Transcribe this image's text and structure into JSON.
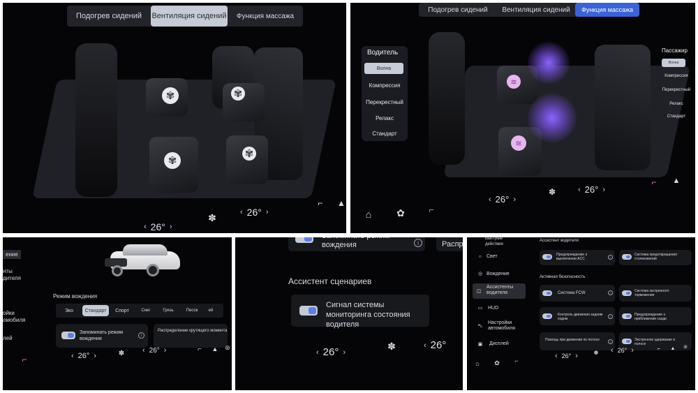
{
  "panel1": {
    "tabs": [
      "Подогрев сидений",
      "Вентиляция сидений",
      "Функция массажа"
    ],
    "active_tab": 1,
    "climate": {
      "left_temp": "26°",
      "right_temp": "26°"
    }
  },
  "panel2": {
    "tabs": [
      "Подогрев сидений",
      "Вентиляция сидений",
      "Функция массажа"
    ],
    "driver_menu": {
      "title": "Водитель",
      "items": [
        "Волна",
        "Компрессия",
        "Перекрестный",
        "Релакс",
        "Стандарт"
      ]
    },
    "passenger_menu": {
      "title": "Пассажир",
      "items": [
        "Волна",
        "Компрессия",
        "Перекрестный",
        "Релакс",
        "Стандарт"
      ]
    },
    "climate": {
      "left_temp": "26°",
      "right_temp": "26°"
    }
  },
  "panel3": {
    "sidebar": [
      "ение",
      "нты\nдителя",
      "ойки\nомобиля",
      "лей"
    ],
    "mode_title": "Режим вождения",
    "modes": [
      "Эко",
      "Стандарт",
      "Спорт",
      "Снег",
      "Грязь",
      "Песок",
      "ей"
    ],
    "remember_label": "Запоминать режим вождения",
    "torque_label": "Распределение крутящего момента",
    "climate": {
      "left_temp": "26°",
      "right_temp": "26°"
    }
  },
  "panel4": {
    "remember_label": "Запоминать режим вождения",
    "right_cut": "Распре",
    "section_title": "Ассистент сценариев",
    "monitor_label": "Сигнал системы мониторинга состояния водителя",
    "climate": {
      "left_temp": "26°",
      "right_temp": "26°"
    }
  },
  "panel5": {
    "sidebar": [
      "Быстрые действия",
      "Свет",
      "Вождение",
      "Ассистенты водителя",
      "HUD",
      "Настройки автомобиля",
      "Дисплей"
    ],
    "section1": "Ассистент водителя",
    "section2": "Активная безопасность",
    "cards": [
      "Предупреждение о выключении ACC",
      "Система предотвращения столкновений",
      "Система FCW",
      "Система экстренного торможения",
      "Контроль движения задним ходом",
      "Предупреждение о приближении сзади",
      "Помощь при движении по полосе",
      "Экстренное удержание в полосе"
    ],
    "climate": {
      "left_temp": "26°",
      "right_temp": "26°"
    }
  }
}
